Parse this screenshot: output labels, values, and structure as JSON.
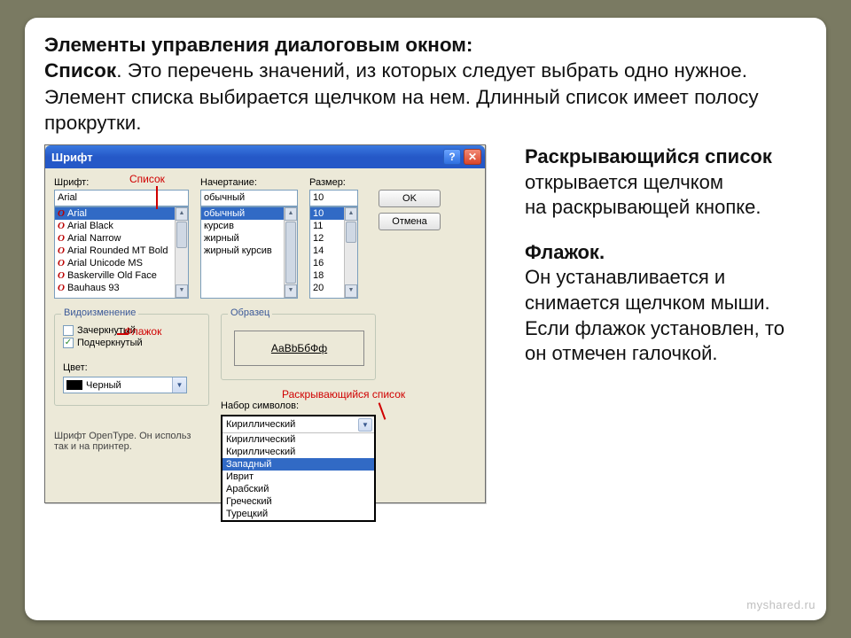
{
  "intro": {
    "l1": "Элементы управления диалоговым окном:",
    "l2a": "Список",
    "l2b": ". Это перечень значений, из которых следует выбрать одно нужное. Элемент списка выбирается щелчком на нем. Длинный список имеет полосу прокрутки."
  },
  "side": {
    "p1a": "Раскрывающийся список",
    "p1b": " открывается щелчком",
    "p1c": " на раскрывающей кнопке.",
    "p2a": "Флажок.",
    "p2b": "Он устанавливается и снимается щелчком мыши. Если флажок установлен, то он отмечен галочкой."
  },
  "dlg": {
    "title": "Шрифт",
    "font_label": "Шрифт:",
    "style_label": "Начертание:",
    "size_label": "Размер:",
    "font_value": "Arial",
    "style_value": "обычный",
    "size_value": "10",
    "fonts": [
      "Arial",
      "Arial Black",
      "Arial Narrow",
      "Arial Rounded MT Bold",
      "Arial Unicode MS",
      "Baskerville Old Face",
      "Bauhaus 93"
    ],
    "styles": [
      "обычный",
      "курсив",
      "жирный",
      "жирный курсив"
    ],
    "sizes": [
      "10",
      "11",
      "12",
      "14",
      "16",
      "18",
      "20"
    ],
    "ok": "OK",
    "cancel": "Отмена",
    "group_effects": "Видоизменение",
    "chk_strike": "Зачеркнутый",
    "chk_underline": "Подчеркнутый",
    "color_label": "Цвет:",
    "color_value": "Черный",
    "group_sample": "Образец",
    "sample_text": "АаBbБбФф",
    "charset_label": "Набор символов:",
    "charset_selected": "Кириллический",
    "charset_items": [
      "Кириллический",
      "Кириллический",
      "Западный",
      "Иврит",
      "Арабский",
      "Греческий",
      "Турецкий"
    ],
    "hint": "Шрифт OpenType. Он использ\nтак и на принтер."
  },
  "annot": {
    "list": "Список",
    "checkbox": "Флажок",
    "dropdown": "Раскрывающийся список"
  },
  "watermark": "myshared.ru"
}
